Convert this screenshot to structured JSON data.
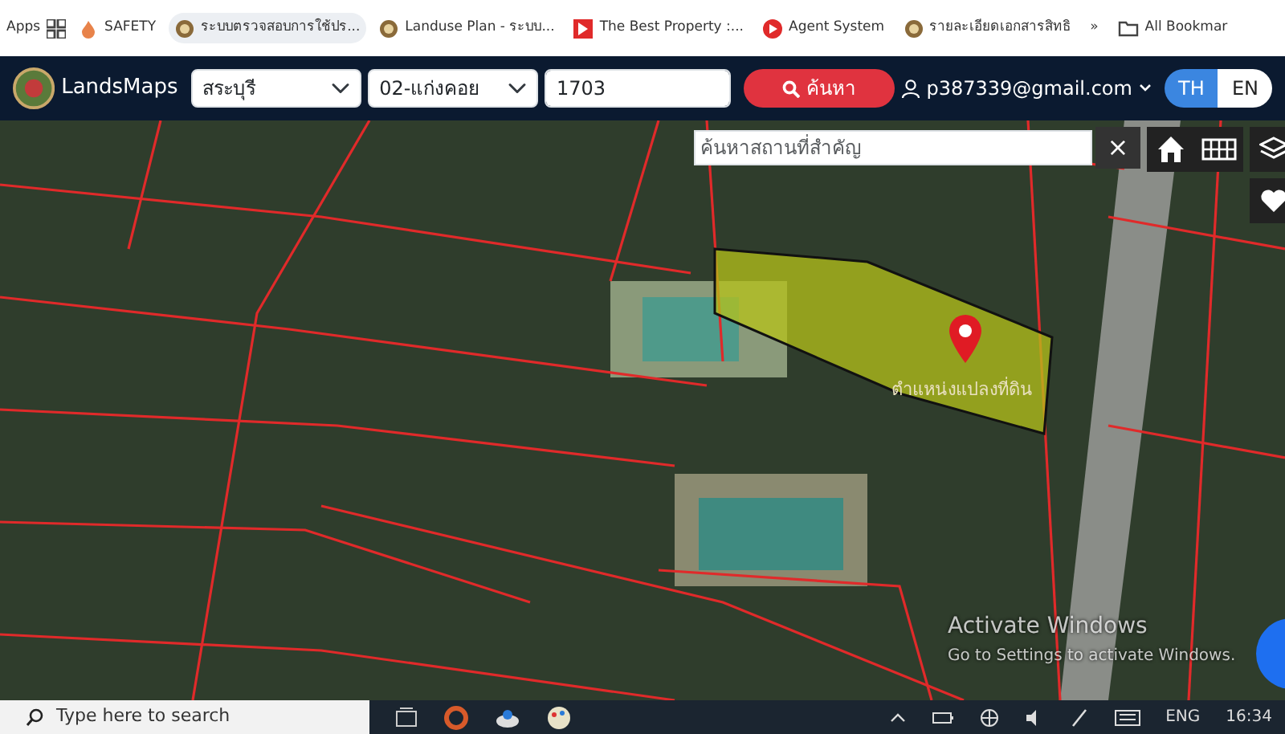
{
  "bookmarks_bar": {
    "apps_label": "Apps",
    "items": [
      {
        "label": "SAFETY",
        "kind": "flame"
      },
      {
        "label": "ระบบตรวจสอบการใช้ปร...",
        "kind": "seal",
        "selected": true
      },
      {
        "label": "Landuse Plan - ระบบ...",
        "kind": "seal",
        "selected": false
      },
      {
        "label": "The Best Property :...",
        "kind": "brand"
      },
      {
        "label": "Agent System",
        "kind": "brand-round"
      },
      {
        "label": "รายละเอียดเอกสารสิทธิ",
        "kind": "seal"
      }
    ],
    "overflow": "»",
    "all_bookmarks": "All Bookmar"
  },
  "navbar": {
    "brand": "LandsMaps",
    "province": "สระบุรี",
    "district": "02-แก่งคอย",
    "parcel_number": "1703",
    "search_button": "ค้นหา",
    "user": "p387339@gmail.com",
    "languages": [
      {
        "label": "TH",
        "selected": true
      },
      {
        "label": "EN",
        "selected": false
      }
    ]
  },
  "map": {
    "place_search": {
      "placeholder": "ค้นหาสถานที่สำคัญ"
    },
    "clear_button": "×",
    "parcel_label": "ตำแหน่งแปลงที่ดิน",
    "activate_windows": {
      "title": "Activate Windows",
      "subtitle": "Go to Settings to activate Windows."
    }
  },
  "taskbar": {
    "search_placeholder": "Type here to search",
    "language": "ENG",
    "time": "16:34"
  }
}
